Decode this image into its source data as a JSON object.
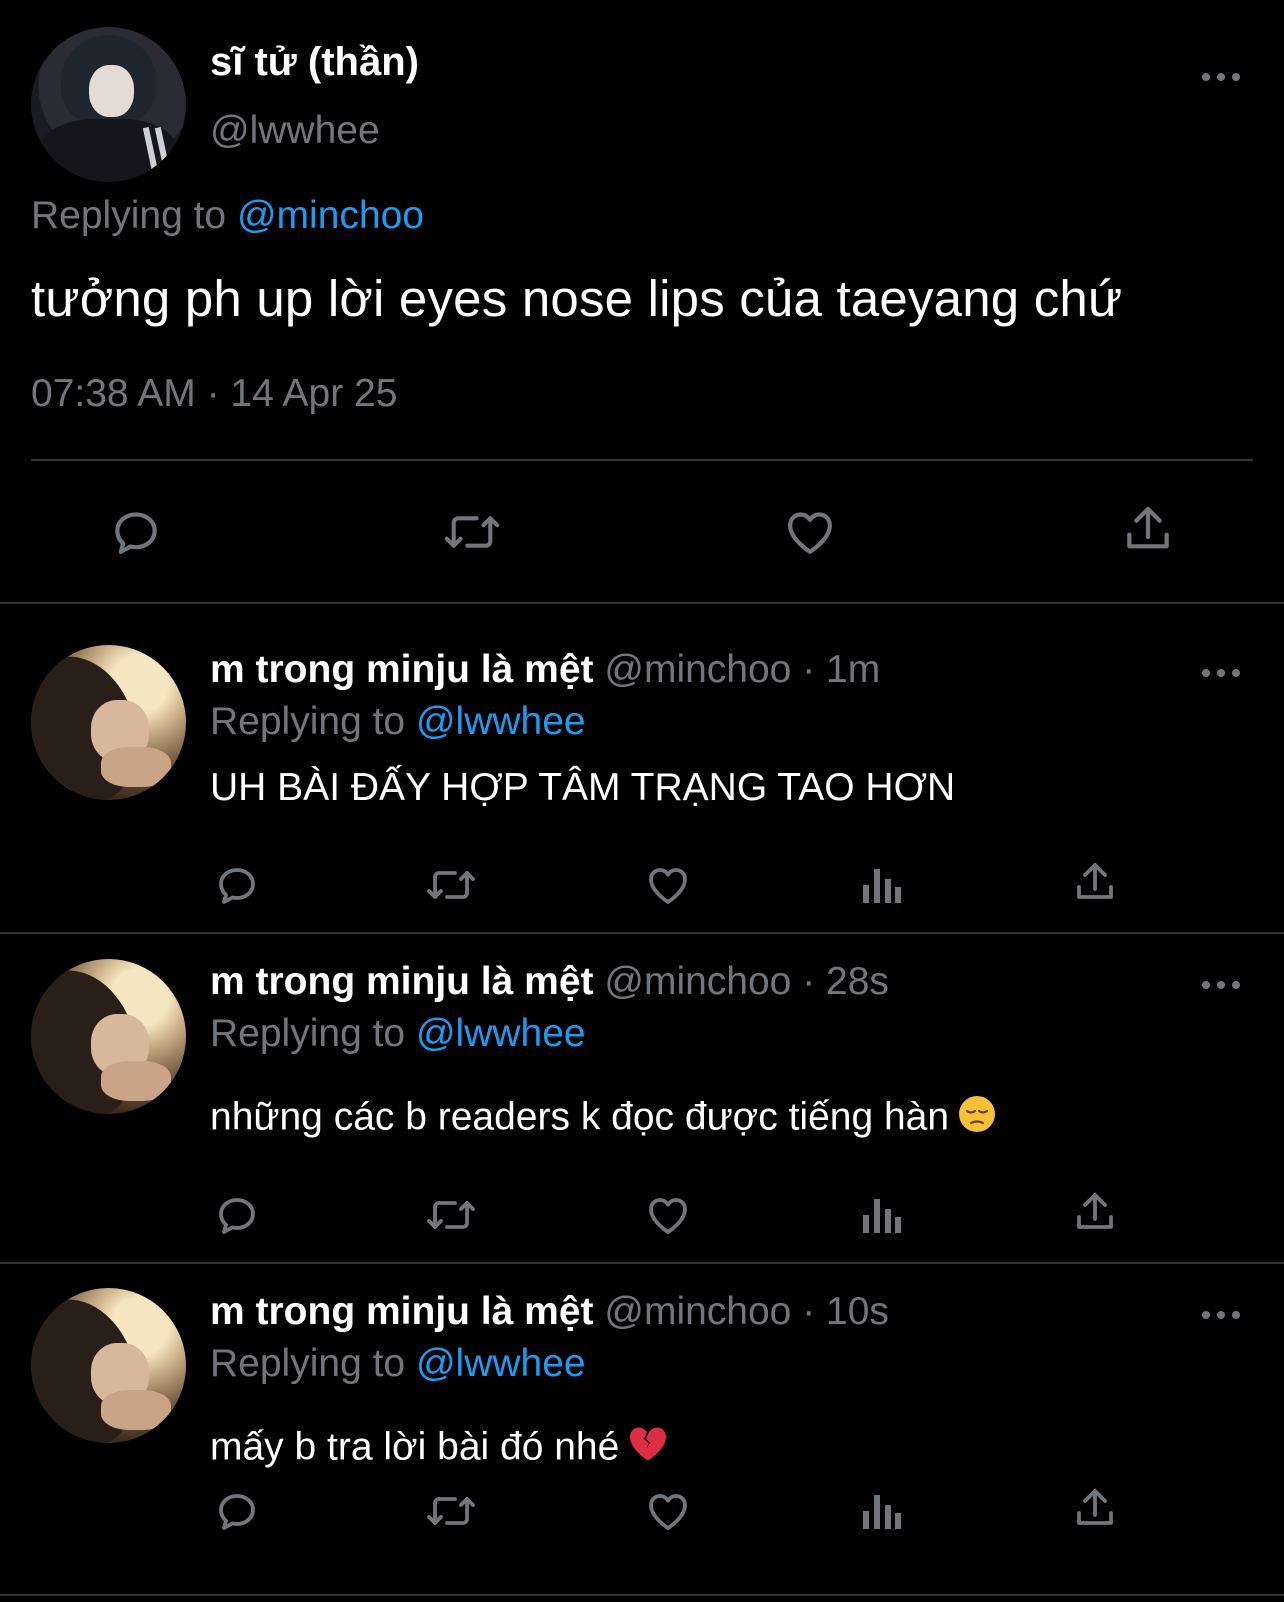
{
  "main_tweet": {
    "author_name": "sĩ tử (thần)",
    "author_handle": "@lwwhee",
    "replying_prefix": "Replying to",
    "replying_to": "@minchoo",
    "text": "tưởng ph up lời eyes nose lips của taeyang chứ",
    "timestamp": "07:38 AM · 14 Apr 25",
    "actions": [
      "reply-icon",
      "retweet-icon",
      "like-icon",
      "share-icon"
    ]
  },
  "replies": [
    {
      "author_name": "m trong minju là mệt",
      "meta": "@minchoo · 1m",
      "replying_prefix": "Replying to",
      "replying_to": "@lwwhee",
      "text": "UH BÀI ĐẤY HỢP TÂM TRẠNG TAO HƠN",
      "emoji": ""
    },
    {
      "author_name": "m trong minju là mệt",
      "meta": "@minchoo · 28s",
      "replying_prefix": "Replying to",
      "replying_to": "@lwwhee",
      "text": "những các b readers k đọc được tiếng hàn",
      "emoji": "pensive-face"
    },
    {
      "author_name": "m trong minju là mệt",
      "meta": "@minchoo · 10s",
      "replying_prefix": "Replying to",
      "replying_to": "@lwwhee",
      "text": "mấy b tra lời bài đó nhé",
      "emoji": "broken-heart"
    }
  ],
  "reply_actions": [
    "reply-icon",
    "retweet-icon",
    "like-icon",
    "analytics-icon",
    "share-icon"
  ],
  "colors": {
    "background": "#000000",
    "text": "#ffffff",
    "muted": "#71767b",
    "link": "#1d9bf0",
    "divider": "#2f3336"
  }
}
